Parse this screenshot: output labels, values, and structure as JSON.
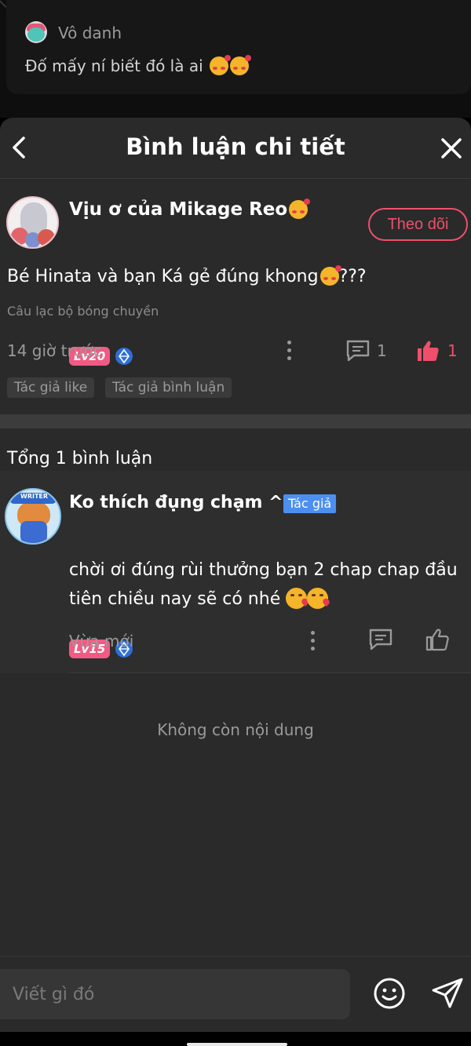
{
  "background_post": {
    "author": "Vô danh",
    "text": "Đố mấy ní biết đó là ai"
  },
  "header": {
    "title": "Bình luận chi tiết"
  },
  "post": {
    "author": "Vịu ơ của Mikage Reo",
    "level": "Lv20",
    "follow_label": "Theo dõi",
    "text": "Bé Hinata và bạn Ká gẻ đúng khong",
    "text_suffix": "???",
    "group": "Câu lạc bộ bóng chuyền",
    "time": "14 giờ trước",
    "comment_count": "1",
    "like_count": "1",
    "tags": [
      "Tác giả like",
      "Tác giả bình luận"
    ]
  },
  "comments": {
    "total_label": "Tổng 1 bình luận",
    "items": [
      {
        "author": "Ko thích đụng chạm ^^",
        "author_tag": "Tác giả",
        "level": "Lv15",
        "text": "chời ơi đúng rùi thưởng bạn 2 chap chap đầu tiên chiều nay sẽ có nhé",
        "time": "Vừa mới",
        "avatar_label": "WRITER"
      }
    ],
    "end_label": "Không còn nội dung"
  },
  "composer": {
    "placeholder": "Viết gì đó"
  },
  "colors": {
    "accent": "#ef4f6b",
    "level_badge": "#f25a83",
    "author_tag": "#4c8ff0",
    "sheet_bg": "#2a2a2a"
  }
}
